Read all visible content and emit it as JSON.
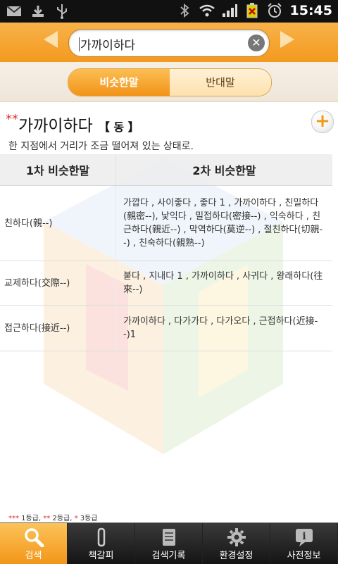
{
  "status_bar": {
    "time": "15:45",
    "icons": [
      "mail-icon",
      "download-icon",
      "usb-icon",
      "bluetooth-icon",
      "wifi-icon",
      "signal-icon",
      "battery-icon",
      "alarm-icon"
    ]
  },
  "search": {
    "value": "가까이하다"
  },
  "tabs": [
    {
      "label": "비슷한말",
      "active": true
    },
    {
      "label": "반대말",
      "active": false
    }
  ],
  "entry": {
    "stars": "**",
    "word": "가까이하다",
    "pos": "【 동 】",
    "definition": "한 지점에서 거리가 조금 떨어져 있는 상태로."
  },
  "table": {
    "headers": [
      "1차 비슷한말",
      "2차 비슷한말"
    ],
    "rows": [
      {
        "primary": "친하다(親--)",
        "secondary": "가깝다 , 사이좋다 , 좋다 1 , 가까이하다 , 친밀하다(親密--), 낯익다 , 밀접하다(密接--) , 익숙하다 , 친근하다(親近--) , 막역하다(莫逆--) , 절친하다(切親--) , 친숙하다(親熟--)"
      },
      {
        "primary": "교제하다(交際--)",
        "secondary": "붙다 , 지내다 1 , 가까이하다 , 사귀다 , 왕래하다(往來--)"
      },
      {
        "primary": "접근하다(接近--)",
        "secondary": "가까이하다 , 다가가다 , 다가오다 , 근접하다(近接--)1"
      }
    ]
  },
  "legend": {
    "s3": "***",
    "l3": " 1등급, ",
    "s2": "**",
    "l2": " 2등급, ",
    "s1": "*",
    "l1": " 3등급"
  },
  "bottom_nav": [
    {
      "label": "검색",
      "icon": "search-icon",
      "active": true
    },
    {
      "label": "책갈피",
      "icon": "paperclip-icon",
      "active": false
    },
    {
      "label": "검색기록",
      "icon": "notepad-icon",
      "active": false
    },
    {
      "label": "환경설정",
      "icon": "gear-icon",
      "active": false
    },
    {
      "label": "사전정보",
      "icon": "info-icon",
      "active": false
    }
  ],
  "colors": {
    "accent_orange": "#f39a1f",
    "star_red": "#e62e2e"
  }
}
